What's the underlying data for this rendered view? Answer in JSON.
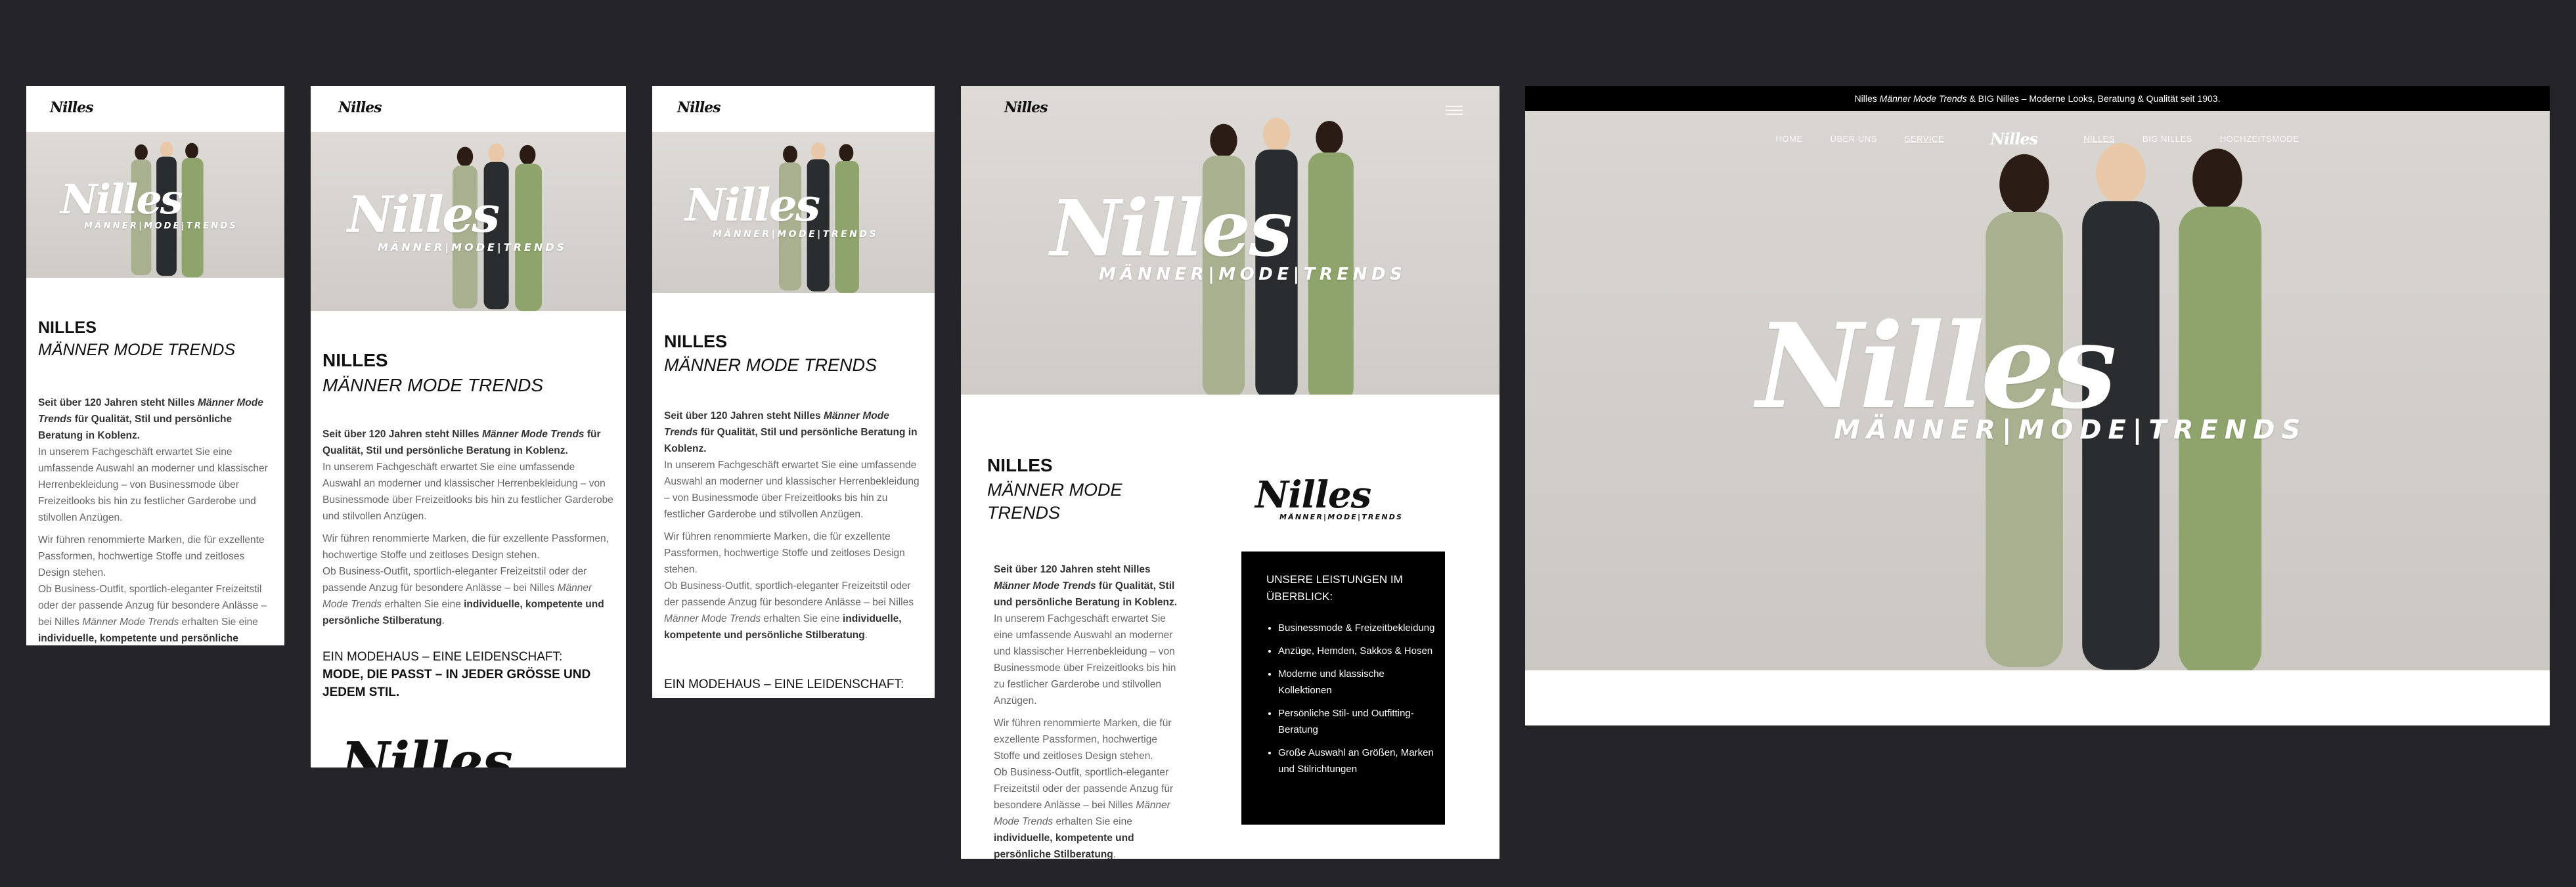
{
  "brand": {
    "logo": "Nilles",
    "tagline": "MÄNNER|MODE|TRENDS"
  },
  "intro": {
    "title": "NILLES",
    "subtitle": "MÄNNER MODE TRENDS"
  },
  "paragraphs": {
    "p1_a": "Seit über 120 Jahren steht Nilles ",
    "p1_em": "Männer Mode Trends",
    "p1_b": " für Qualität, Stil und persönliche Beratung in Koblenz.",
    "p2": "In unserem Fachgeschäft erwartet Sie eine umfassende Auswahl an moderner und klassischer Herrenbekleidung – von Businessmode über Freizeitlooks bis hin zu festlicher Garderobe und stilvollen Anzügen.",
    "p3": "Wir führen renommierte Marken, die für exzellente Passformen, hochwertige Stoffe und zeitloses Design stehen.",
    "p4_a": "Ob Business-Outfit, sportlich-eleganter Freizeitstil oder der passende Anzug für besondere Anlässe – bei Nilles ",
    "p4_em": "Männer Mode Trends",
    "p4_b": " erhalten Sie eine ",
    "p4_strong": "individuelle, kompetente und persönliche Stilberatung",
    "p4_end": "."
  },
  "slogan": {
    "line1": "EIN MODEHAUS – EINE LEIDENSCHAFT:",
    "line2": "MODE, DIE PASST – IN JEDER GRÖSSE UND JEDEM STIL."
  },
  "services": {
    "heading": "UNSERE LEISTUNGEN IM ÜBERBLICK:",
    "items": [
      "Businessmode & Freizeitbekleidung",
      "Anzüge, Hemden, Sakkos & Hosen",
      "Moderne und klassische Kollektionen",
      "Persönliche Stil- und Outfitting-Beratung",
      "Große Auswahl an Größen, Marken und Stilrichtungen"
    ]
  },
  "desktop": {
    "topbar_a": "Nilles ",
    "topbar_em": "Männer Mode Trends",
    "topbar_b": " & BIG Nilles – Moderne Looks, Beratung & Qualität seit 1903.",
    "nav_left": [
      "HOME",
      "ÜBER UNS",
      "SERVICE"
    ],
    "nav_right": [
      "NILLES",
      "BIG NILLES",
      "HOCHZEITSMODE"
    ]
  },
  "colors": {
    "canvas": "#252428",
    "suit_green": "#8ea46c",
    "suit_dark": "#2a2d2f",
    "hero_bg": "#d6d3cf",
    "black": "#000000"
  }
}
